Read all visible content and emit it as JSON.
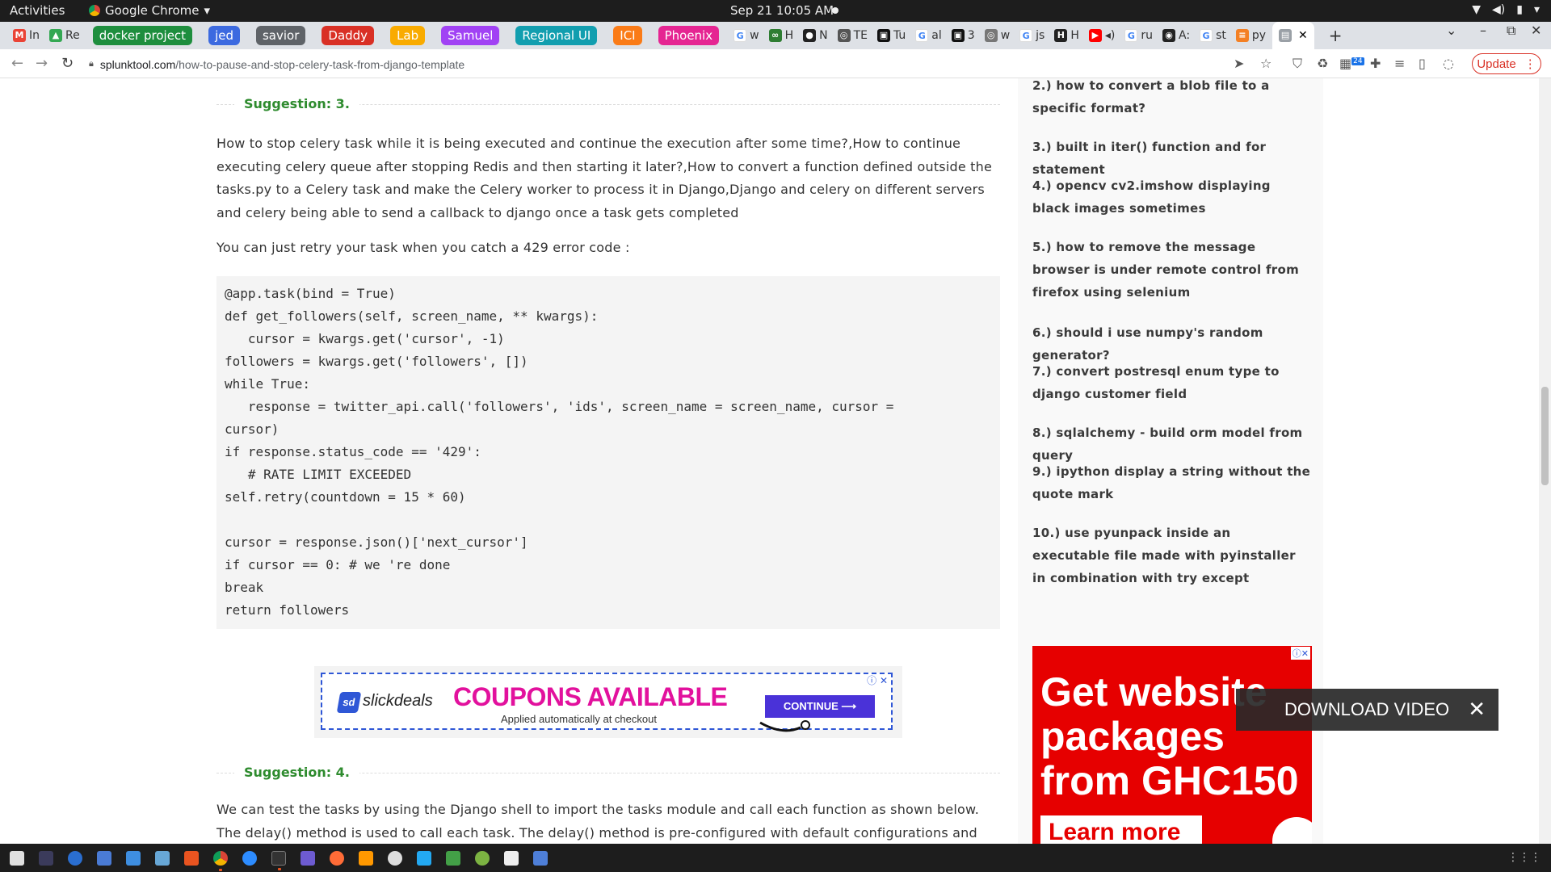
{
  "topbar": {
    "activities": "Activities",
    "app_name": "Google Chrome",
    "clock": "Sep 21  10:05 AM"
  },
  "tabs": {
    "items": [
      {
        "label": "In",
        "icon": "gmail-icon",
        "color": "#ea4335"
      },
      {
        "label": "Re",
        "icon": "google-drive-icon",
        "color": "#34a853"
      }
    ],
    "groups": [
      {
        "label": "docker project",
        "color": "#1e8e3e"
      },
      {
        "label": "jed",
        "color": "#3c6ae0"
      },
      {
        "label": "savior",
        "color": "#5f6368"
      },
      {
        "label": "Daddy",
        "color": "#d93025"
      },
      {
        "label": "Lab",
        "color": "#f9ab00"
      },
      {
        "label": "Samuel",
        "color": "#a142f4"
      },
      {
        "label": "Regional UI",
        "color": "#129eaf"
      },
      {
        "label": "ICI",
        "color": "#fa7b17"
      },
      {
        "label": "Phoenix",
        "color": "#e52592"
      }
    ],
    "small_tabs": [
      "w",
      "H",
      "N",
      "TE",
      "Tu",
      "al",
      "3",
      "w",
      "js",
      "H",
      "",
      "ru",
      "A:",
      "st",
      "py"
    ],
    "active_tab_label": ""
  },
  "toolbar": {
    "url_domain": "splunktool.com",
    "url_path": "/how-to-pause-and-stop-celery-task-from-django-template",
    "update_label": "Update",
    "badge_count": "24"
  },
  "article": {
    "suggestion3_label": "Suggestion: 3.",
    "suggestion3_paragraph": "How to stop celery task while it is being executed and continue the execution after some time?,How to continue executing celery queue after stopping Redis and then starting it later?,How to convert a function defined outside the tasks.py to a Celery task and make the Celery worker to process it in Django,Django and celery on different servers and celery being able to send a callback to django once a task gets completed",
    "retry_paragraph": "You can just retry your task when you catch a 429 error code :",
    "code": "@app.task(bind = True)\ndef get_followers(self, screen_name, ** kwargs):\n   cursor = kwargs.get('cursor', -1)\nfollowers = kwargs.get('followers', [])\nwhile True:\n   response = twitter_api.call('followers', 'ids', screen_name = screen_name, cursor =\ncursor)\nif response.status_code == '429':\n   # RATE LIMIT EXCEEDED\nself.retry(countdown = 15 * 60)\n\ncursor = response.json()['next_cursor']\nif cursor == 0: # we 're done\nbreak\nreturn followers",
    "suggestion4_label": "Suggestion: 4.",
    "suggestion4_paragraph": "We can test the tasks by using the Django shell to import the tasks module and call each function as shown below. The delay() method is used to call each task. The delay() method is pre-configured with default configurations and only"
  },
  "ad_slickdeals": {
    "logo_text": "slickdeals",
    "logo_mark": "sd",
    "headline": "COUPONS AVAILABLE",
    "subline": "Applied automatically at checkout",
    "cta": "CONTINUE ⟶"
  },
  "sidebar": {
    "items": [
      "2.) how to convert a blob file to a specific format?",
      "3.) built in iter() function and for statement",
      "4.) opencv cv2.imshow displaying black images sometimes",
      "5.) how to remove the message browser is under remote control from firefox using selenium",
      "6.) should i use numpy's random generator?",
      "7.) convert postresql enum type to django customer field",
      "8.) sqlalchemy - build orm model from query",
      "9.) ipython display a string without the quote mark",
      "10.) use pyunpack inside an executable file made with pyinstaller in combination with try except"
    ]
  },
  "ad_vodafone": {
    "headline": "Get website packages from GHC150",
    "cta": "Learn more"
  },
  "download_video": {
    "label": "DOWNLOAD VIDEO"
  }
}
